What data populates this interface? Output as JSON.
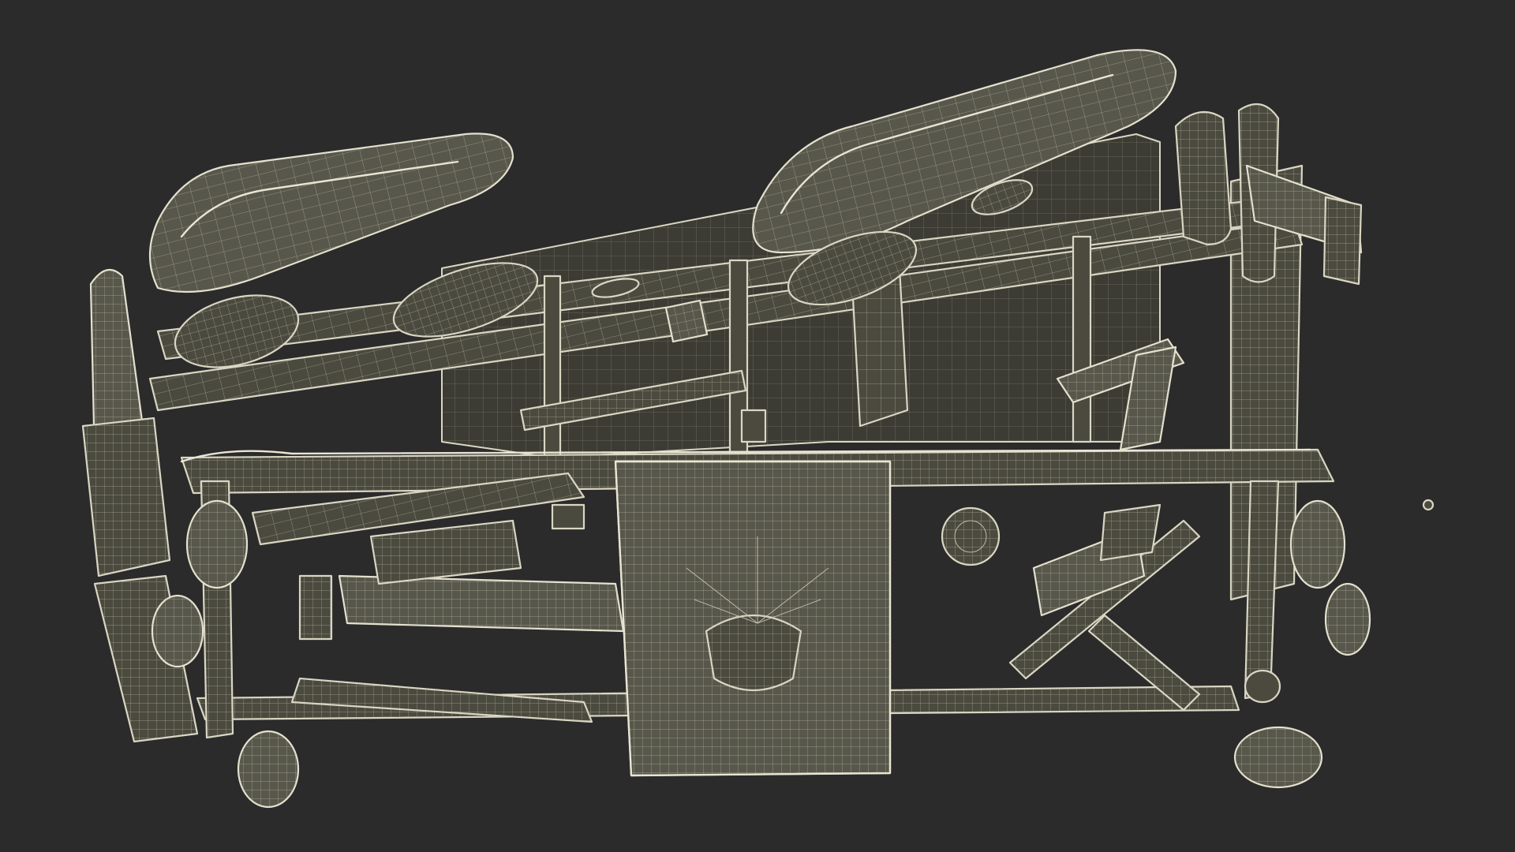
{
  "scene": {
    "subject": "hospital-bed-wireframe-render",
    "background_color": "#2b2b2b",
    "model_fill_color": "#4a4a3f",
    "wire_color": "#d9d6c3"
  }
}
